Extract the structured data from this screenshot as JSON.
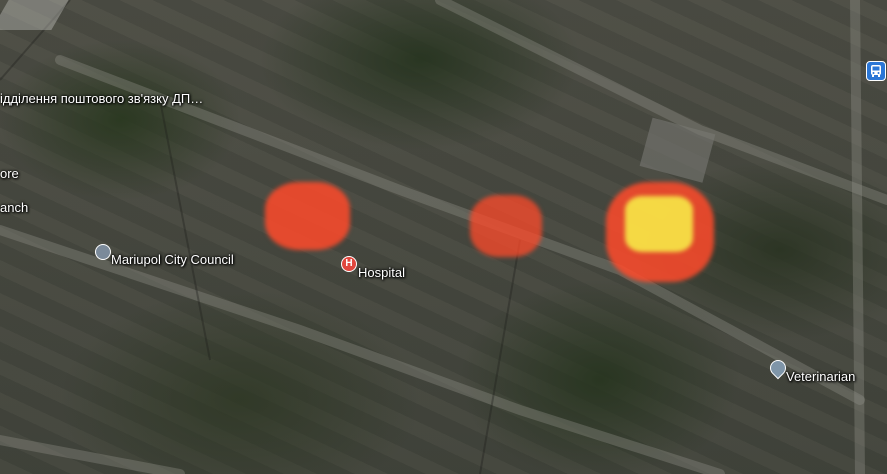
{
  "map": {
    "labels": {
      "postal": "ідділення поштового зв'язку ДП…",
      "store": "ore",
      "branch": "anch",
      "city_council": "Mariupol City Council",
      "hospital": "Hospital",
      "veterinarian": "Veterinarian"
    },
    "icons": {
      "hospital": "H",
      "city_council": "government-icon",
      "veterinarian": "pin-icon",
      "transit": "bus-icon"
    },
    "colors": {
      "fire_red": "#ff4a2a",
      "fire_yellow": "#f5e046",
      "hospital_red": "#e0463d",
      "transit_blue": "#2a76d6"
    }
  }
}
